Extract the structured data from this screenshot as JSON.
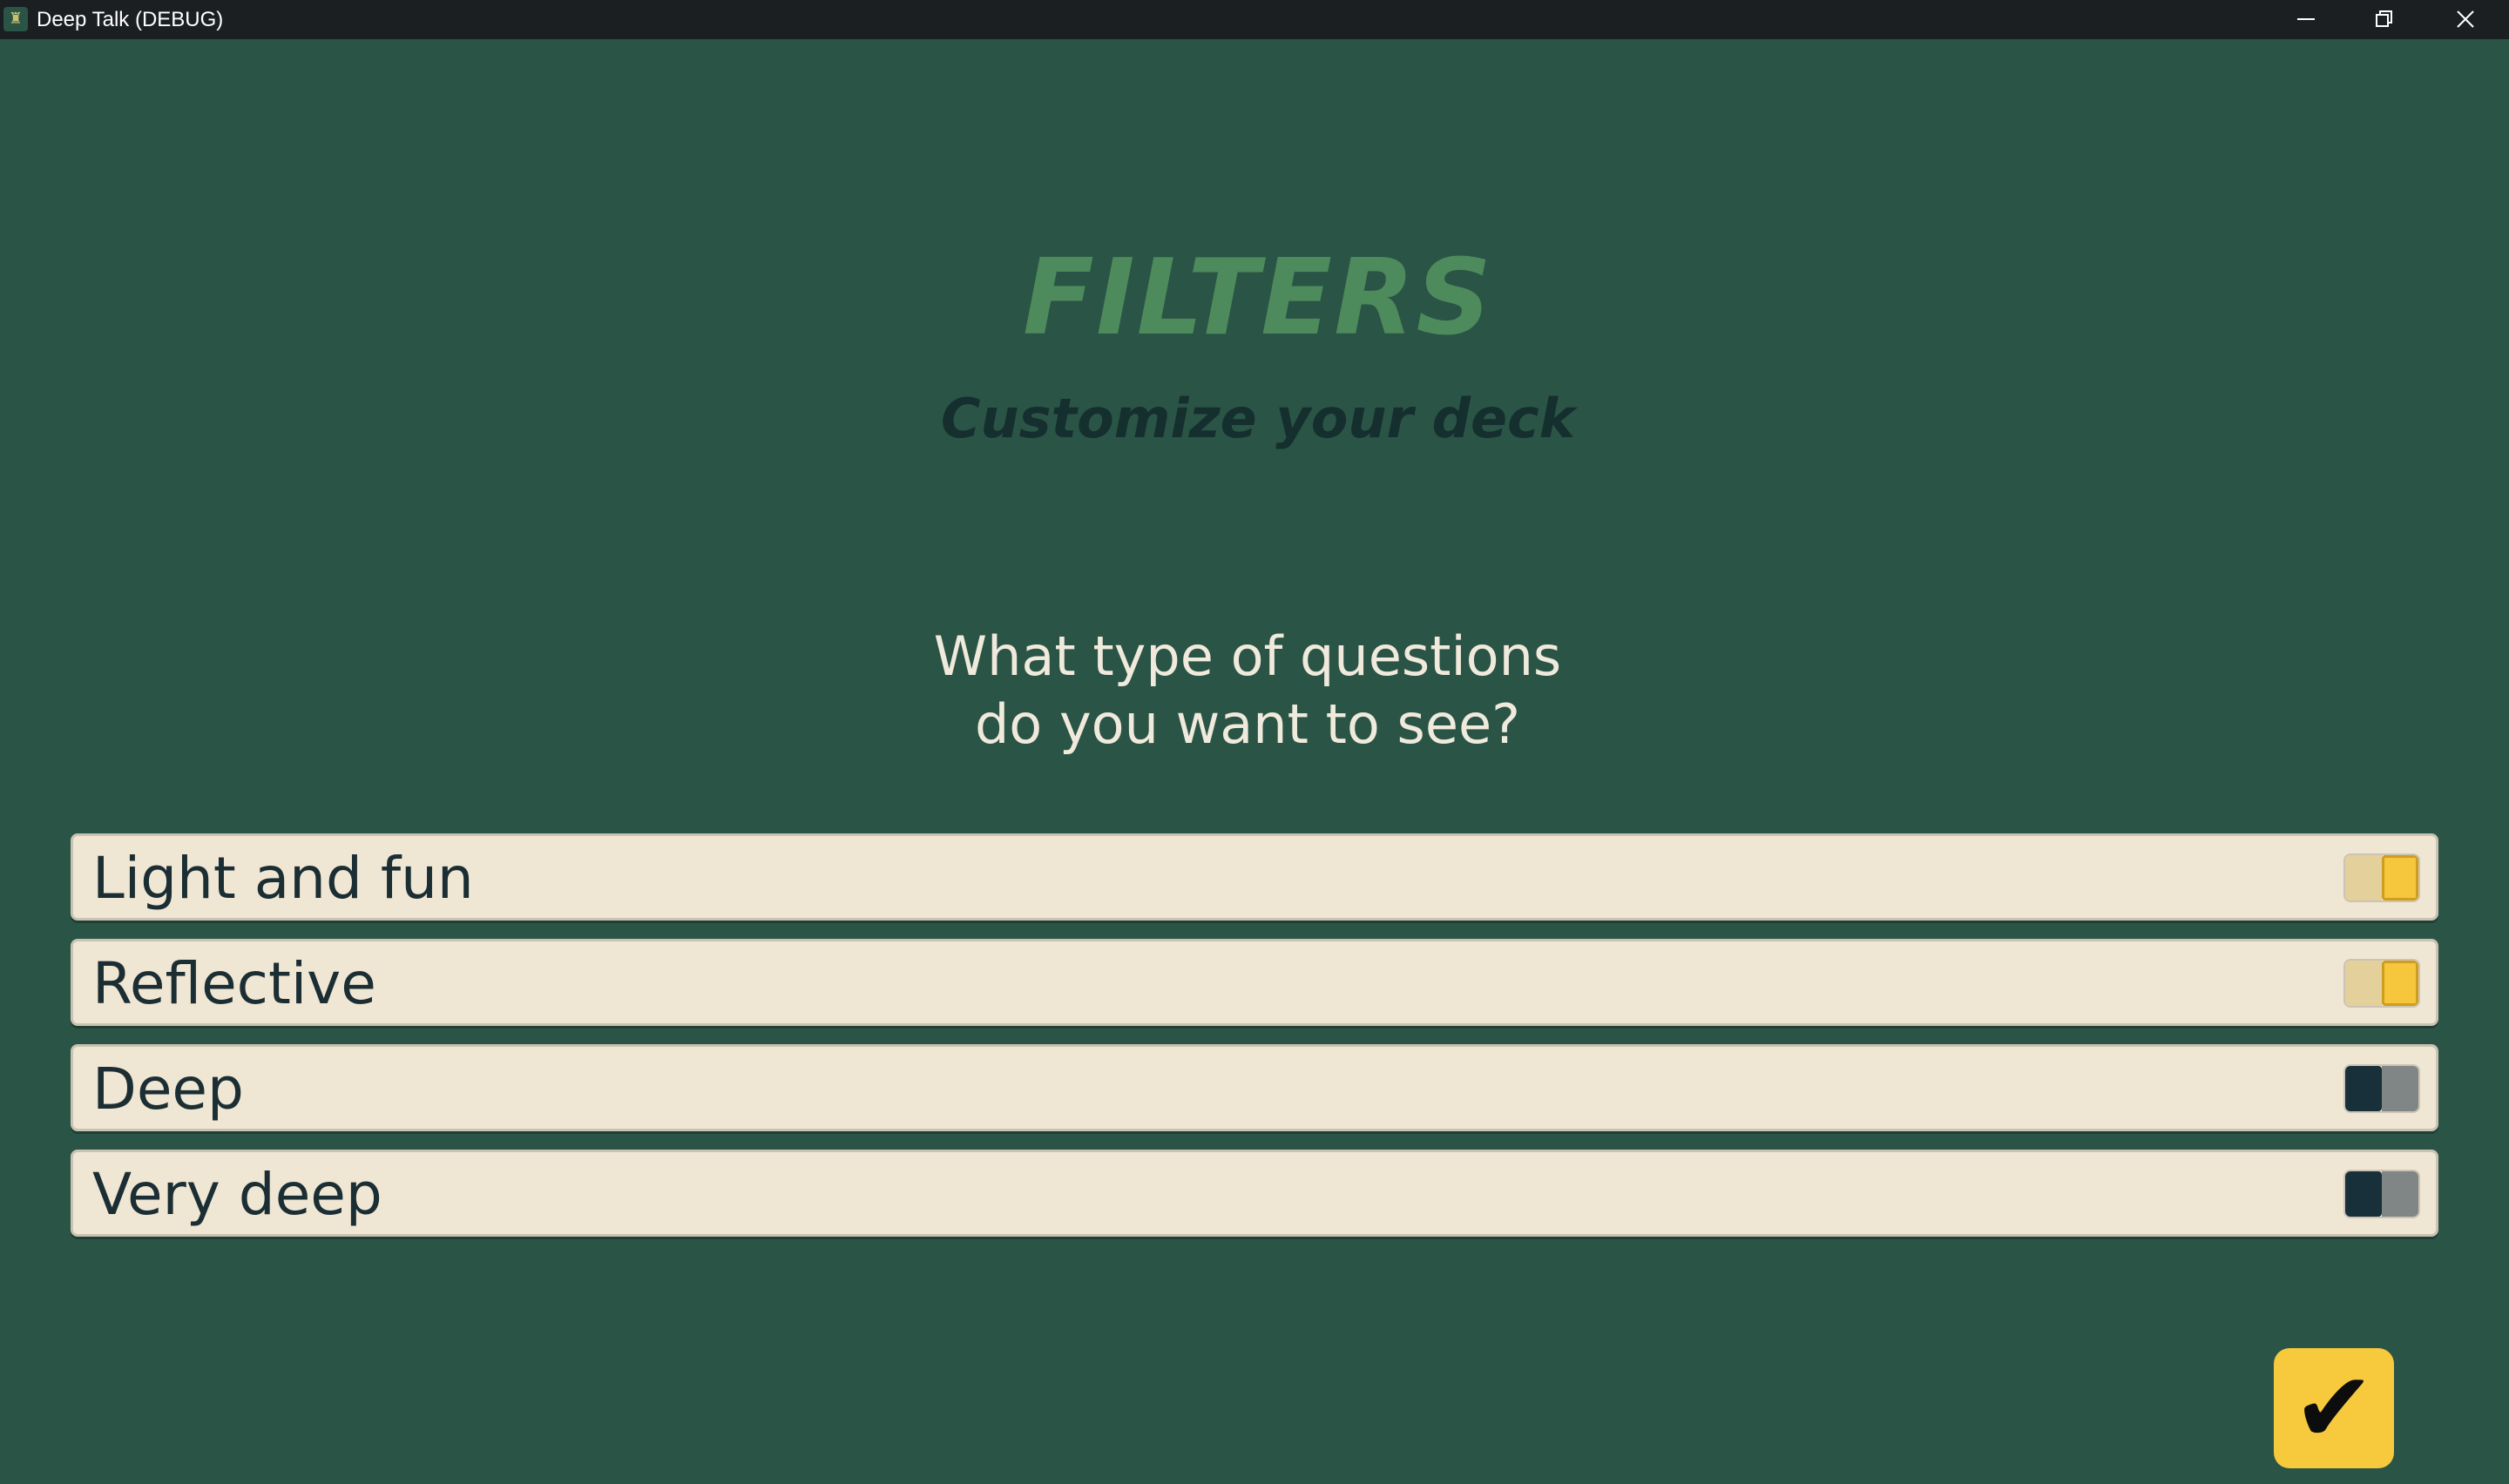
{
  "window": {
    "title": "Deep Talk (DEBUG)",
    "app_icon_glyph": "♜"
  },
  "screen": {
    "heading": "FILTERS",
    "subheading": "Customize your deck",
    "question_line1": "What type of questions",
    "question_line2": "do you want to see?"
  },
  "filters": [
    {
      "label": "Light and fun",
      "enabled": true
    },
    {
      "label": "Reflective",
      "enabled": true
    },
    {
      "label": "Deep",
      "enabled": false
    },
    {
      "label": "Very deep",
      "enabled": false
    }
  ],
  "confirm": {
    "glyph": "✔",
    "icon": "checkmark-icon"
  },
  "colors": {
    "background": "#2a5446",
    "heading": "#4d8a5c",
    "toggle_on": "#f6c63c",
    "toggle_off": "#17303a",
    "confirm": "#f7c93c"
  }
}
